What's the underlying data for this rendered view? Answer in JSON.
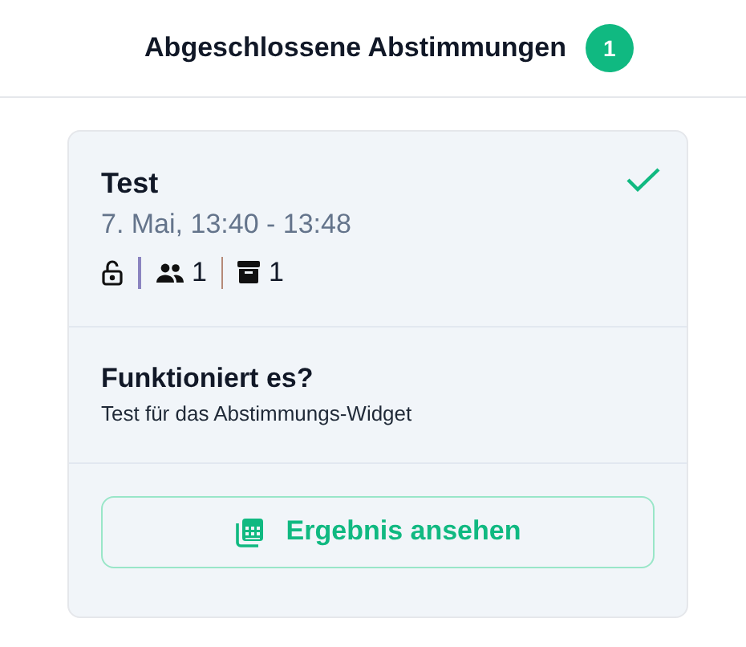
{
  "header": {
    "title": "Abgeschlossene Abstimmungen",
    "count": "1"
  },
  "poll": {
    "title": "Test",
    "time": "7. Mai, 13:40 - 13:48",
    "completed": true,
    "locked": false,
    "participants": "1",
    "archived": "1",
    "question": {
      "title": "Funktioniert es?",
      "description": "Test für das Abstimmungs-Widget"
    },
    "button": {
      "label": "Ergebnis ansehen"
    }
  }
}
